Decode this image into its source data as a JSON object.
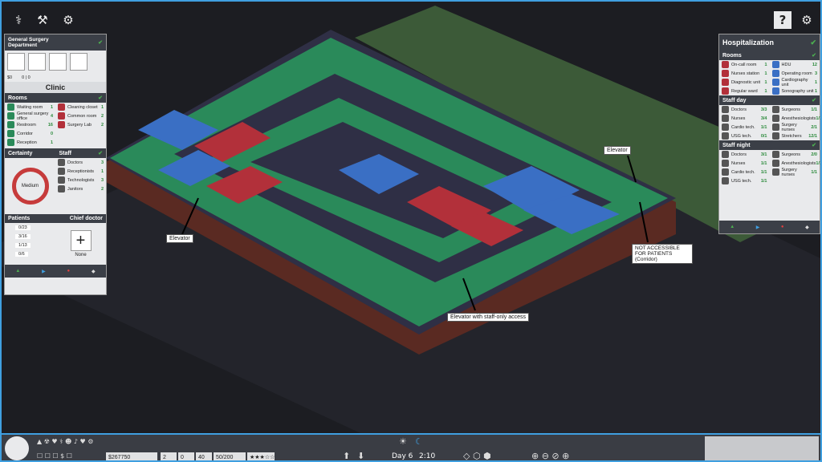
{
  "top_left_icons": [
    "doctor-icon",
    "hammer-icon",
    "gears-icon"
  ],
  "top_right_icons": [
    "help-icon",
    "settings-icon"
  ],
  "help_glyph": "?",
  "left_panel": {
    "department_title": "General Surgery Department",
    "money": "$0",
    "patients_counter": "0 | 0",
    "clinic_title": "Clinic",
    "rooms_title": "Rooms",
    "rooms": [
      {
        "label": "Waiting room",
        "count": "1"
      },
      {
        "label": "General surgery office",
        "count": "4"
      },
      {
        "label": "Restroom",
        "count": "16"
      },
      {
        "label": "Corridor",
        "count": "0"
      },
      {
        "label": "Reception",
        "count": "1"
      }
    ],
    "rooms_right": [
      {
        "label": "Cleaning closet",
        "count": "1"
      },
      {
        "label": "Common room",
        "count": "2"
      },
      {
        "label": "Surgery Lab",
        "count": "2"
      }
    ],
    "certainty_title": "Certainty",
    "certainty_value": "Medium",
    "staff_title": "Staff",
    "staff": [
      {
        "label": "Doctors",
        "count": "3"
      },
      {
        "label": "Receptionists",
        "count": "1"
      },
      {
        "label": "Technologists",
        "count": "3"
      },
      {
        "label": "Janitors",
        "count": "2"
      }
    ],
    "patients_title": "Patients",
    "patients": [
      "0/23",
      "3/16",
      "1/13",
      "0/6"
    ],
    "chief_title": "Chief doctor",
    "chief_value": "None",
    "chief_add": "+"
  },
  "right_panel": {
    "title": "Hospitalization",
    "rooms_title": "Rooms",
    "rooms_left": [
      {
        "label": "On-call room",
        "count": "1"
      },
      {
        "label": "Nurses station",
        "count": "1"
      },
      {
        "label": "Diagnostic unit",
        "count": "1"
      },
      {
        "label": "Regular ward",
        "count": "1"
      }
    ],
    "rooms_right": [
      {
        "label": "HDU",
        "count": "12"
      },
      {
        "label": "Operating room",
        "count": "3"
      },
      {
        "label": "Cardiography unit",
        "count": "1"
      },
      {
        "label": "Sonography unit",
        "count": "1"
      }
    ],
    "staff_day_title": "Staff day",
    "staff_day_left": [
      {
        "label": "Doctors",
        "count": "3/3"
      },
      {
        "label": "Nurses",
        "count": "3/4"
      },
      {
        "label": "Cardio tech.",
        "count": "1/1"
      },
      {
        "label": "USG tech.",
        "count": "0/1"
      }
    ],
    "staff_day_right": [
      {
        "label": "Surgeons",
        "count": "1/1"
      },
      {
        "label": "Anesthesiologists",
        "count": "1/1"
      },
      {
        "label": "Surgery nurses",
        "count": "2/1"
      },
      {
        "label": "Stretchers",
        "count": "12/1"
      }
    ],
    "staff_night_title": "Staff night",
    "staff_night_left": [
      {
        "label": "Doctors",
        "count": "3/1"
      },
      {
        "label": "Nurses",
        "count": "1/1"
      },
      {
        "label": "Cardio tech.",
        "count": "1/1"
      },
      {
        "label": "USG tech.",
        "count": "1/1"
      }
    ],
    "staff_night_right": [
      {
        "label": "Surgeons",
        "count": "2/0"
      },
      {
        "label": "Anesthesiologists",
        "count": "1/1"
      },
      {
        "label": "Surgery nurses",
        "count": "1/1"
      }
    ]
  },
  "annotations": {
    "elevator_left": "Elevator",
    "elevator_right": "Elevator",
    "staff_elevator": "Elevator with staff-only access",
    "not_accessible": "NOT ACCESSIBLE FOR PATIENTS (Corridor)"
  },
  "bottom_bar": {
    "money": "$267750",
    "stat_a": "2",
    "stat_b": "0",
    "stat_c": "40",
    "capacity": "50/200",
    "rating": "★★★☆☆",
    "day": "Day 6",
    "time": "2:10"
  },
  "colors": {
    "accent": "#3f9fe0",
    "ground": "#1c1d22",
    "grass": "#3c5a38",
    "floor": "#2f2f45",
    "corridor": "#2a8a5a",
    "blue_room": "#3a6fc4",
    "red_room": "#b2303a",
    "brick": "#5a2a22"
  }
}
